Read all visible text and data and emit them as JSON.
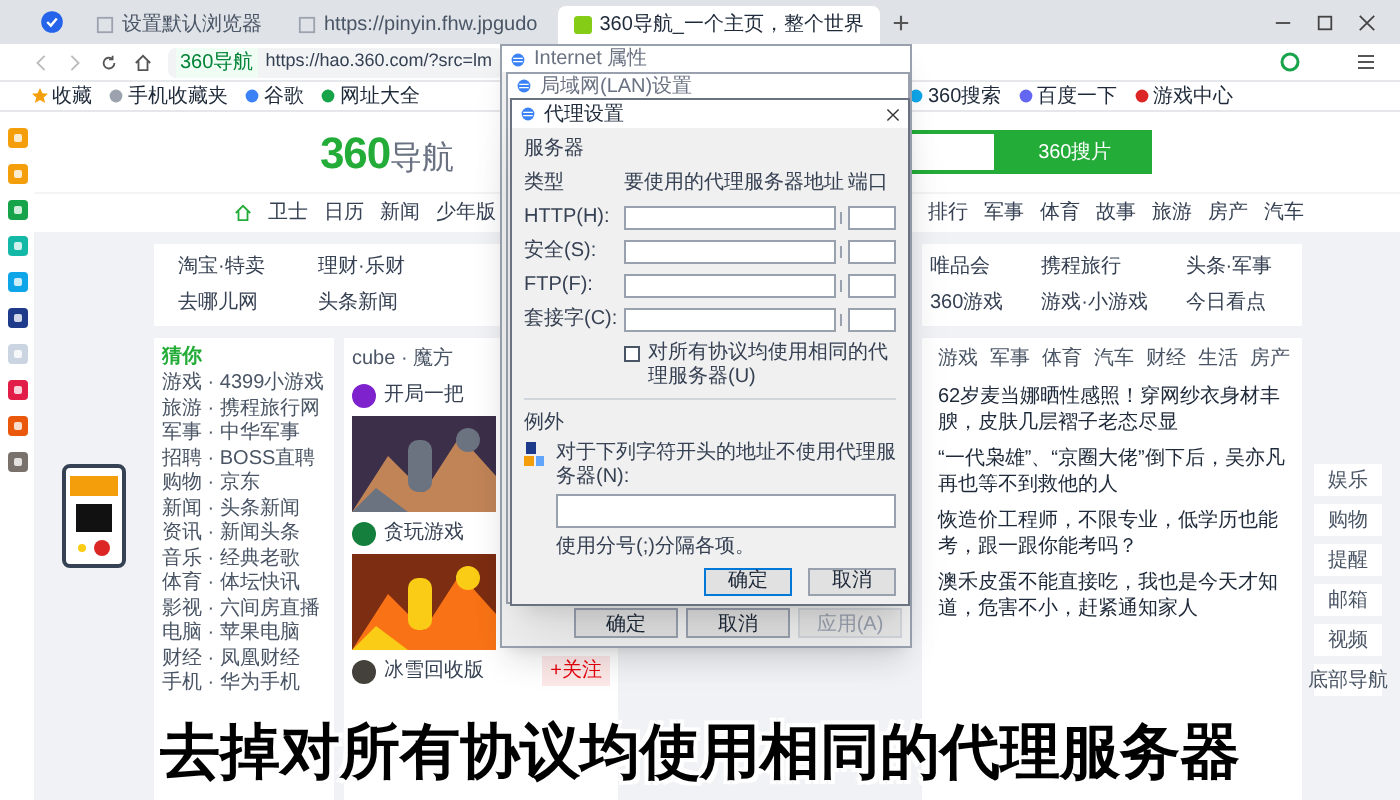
{
  "tabs": [
    {
      "label": "设置默认浏览器",
      "selected": false
    },
    {
      "label": "https://pinyin.fhw.jpgudo",
      "selected": false
    },
    {
      "label": "360导航_一个主页，整个世界",
      "selected": true
    }
  ],
  "address": {
    "site_label": "360导航",
    "url": "https://hao.360.com/?src=lm"
  },
  "bookmarks": [
    "收藏",
    "手机收藏夹",
    "谷歌",
    "网址大全",
    "360搜索",
    "百度一下",
    "游戏中心"
  ],
  "page": {
    "logo_number": "360",
    "logo_text": "导航",
    "search_button": "360搜片",
    "nav_left": [
      "卫士",
      "日历",
      "新闻",
      "少年版"
    ],
    "nav_right": [
      "排行",
      "军事",
      "体育",
      "故事",
      "旅游",
      "房产",
      "汽车"
    ],
    "hot_left": [
      "淘宝·特卖",
      "理财·乐财",
      "去哪儿网",
      "头条新闻"
    ],
    "hot_right": [
      "唯品会",
      "携程旅行",
      "头条·军事",
      "360游戏",
      "游戏·小游戏",
      "今日看点"
    ],
    "menu_title": "猜你",
    "menu": [
      "游戏 · 4399小游戏",
      "旅游 · 携程旅行网",
      "军事 · 中华军事",
      "招聘 · BOSS直聘",
      "购物 · 京东",
      "新闻 · 头条新闻",
      "资讯 · 新闻头条",
      "音乐 · 经典老歌",
      "体育 · 体坛快讯",
      "影视 · 六间房直播",
      "电脑 · 苹果电脑",
      "财经 · 凤凰财经",
      "手机 · 华为手机"
    ],
    "feed_header": "cube · 魔方",
    "feed": [
      {
        "author": "开局一把",
        "follow": false
      },
      {
        "author": "贪玩游戏",
        "follow": false
      },
      {
        "author": "冰雪回收版",
        "follow": true,
        "follow_label": "+关注"
      }
    ],
    "news_tabs": [
      "游戏",
      "军事",
      "体育",
      "汽车",
      "财经",
      "生活",
      "房产"
    ],
    "news": [
      "62岁麦当娜晒性感照！穿网纱衣身材丰腴，皮肤几层褶子老态尽显",
      "“一代枭雄”、“京圈大佬”倒下后，吴亦凡再也等不到救他的人",
      "恢造价工程师，不限专业，低学历也能考，跟一跟你能考吗？",
      "澳禾皮蛋不能直接吃，我也是今天才知道，危害不小，赶紧通知家人"
    ],
    "dock": [
      "娱乐",
      "购物",
      "提醒",
      "邮箱",
      "视频",
      "底部导航"
    ]
  },
  "internet_options": {
    "title": "Internet 属性",
    "buttons": [
      {
        "label": "确定",
        "disabled": false
      },
      {
        "label": "取消",
        "disabled": false
      },
      {
        "label": "应用(A)",
        "disabled": true
      }
    ]
  },
  "lan_settings": {
    "title": "局域网(LAN)设置"
  },
  "proxy_settings": {
    "title": "代理设置",
    "servers_label": "服务器",
    "type_header": "类型",
    "address_header": "要使用的代理服务器地址",
    "port_header": "端口",
    "rows": [
      {
        "label": "HTTP(H):"
      },
      {
        "label": "安全(S):"
      },
      {
        "label": "FTP(F):"
      },
      {
        "label": "套接字(C):"
      }
    ],
    "same_proxy": {
      "label": "对所有协议均使用相同的代理服务器(U)",
      "checked": false
    },
    "exceptions_label": "例外",
    "exceptions_hint": "对于下列字符开头的地址不使用代理服务器(N):",
    "separator_note": "使用分号(;)分隔各项。",
    "buttons": [
      "确定",
      "取消"
    ]
  },
  "subtitle": "去掉对所有协议均使用相同的代理服务器"
}
